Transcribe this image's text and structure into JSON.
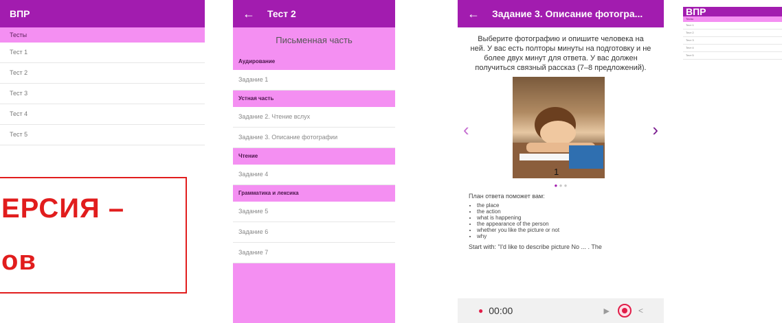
{
  "panel1": {
    "app_title": "ВПР",
    "selected_item": "Тесты",
    "items": [
      "Тест 1",
      "Тест 2",
      "Тест 3",
      "Тест 4",
      "Тест 5"
    ],
    "overlay_line1": "ЕРСИЯ –",
    "overlay_line2": "ов"
  },
  "panel2": {
    "back_icon": "arrow-left-icon",
    "title": "Тест 2",
    "subheader": "Письменная часть",
    "sections": [
      {
        "title": "Аудирование",
        "items": [
          "Задание 1"
        ]
      },
      {
        "title": "Устная часть",
        "items": [
          "Задание 2. Чтение вслух",
          "Задание 3. Описание фотографии"
        ]
      },
      {
        "title": "Чтение",
        "items": [
          "Задание 4"
        ]
      },
      {
        "title": "Грамматика и лексика",
        "items": [
          "Задание 5",
          "Задание 6",
          "Задание 7"
        ]
      }
    ]
  },
  "panel3": {
    "back_icon": "arrow-left-icon",
    "title": "Задание 3. Описание фотогра...",
    "instruction": "Выберите фотографию и опишите человека на ней. У вас есть полторы минуты на подготовку и не более двух минут для ответа. У вас должен получиться связный рассказ (7–8 предложений).",
    "photo_number": "1",
    "carousel_prev_icon": "chevron-left-icon",
    "carousel_next_icon": "chevron-right-icon",
    "plan_title": "План ответа поможет вам:",
    "plan_items": [
      "the place",
      "the action",
      "what is happening",
      "the appearance of the person",
      "whether you like the picture or not",
      "why"
    ],
    "start_with": "Start with: \"I'd like to describe picture No ... . The",
    "timer": "00:00",
    "colors": {
      "accent": "#a21caf",
      "pink": "#f48ff2",
      "record": "#e11d48"
    }
  },
  "panel4": {
    "app_title": "ВПР",
    "selected_item": "Тесты",
    "items": [
      "Тест 1",
      "Тест 2",
      "Тест 3",
      "Тест 4",
      "Тест 5"
    ]
  }
}
